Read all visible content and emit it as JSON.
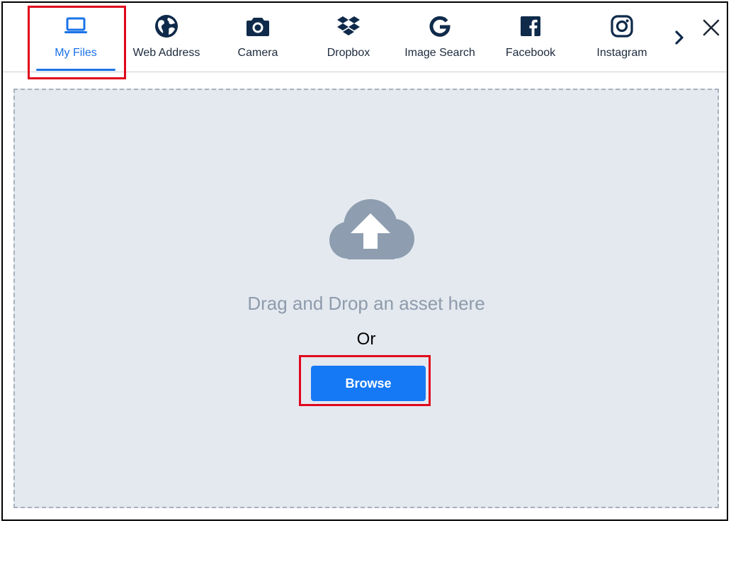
{
  "tabs": [
    {
      "label": "My Files",
      "icon": "laptop-icon",
      "active": true
    },
    {
      "label": "Web Address",
      "icon": "globe-icon",
      "active": false
    },
    {
      "label": "Camera",
      "icon": "camera-icon",
      "active": false
    },
    {
      "label": "Dropbox",
      "icon": "dropbox-icon",
      "active": false
    },
    {
      "label": "Image Search",
      "icon": "google-icon",
      "active": false
    },
    {
      "label": "Facebook",
      "icon": "facebook-icon",
      "active": false
    },
    {
      "label": "Instagram",
      "icon": "instagram-icon",
      "active": false
    }
  ],
  "nav": {
    "more_icon": "chevron-right-icon",
    "close_icon": "close-icon"
  },
  "dropzone": {
    "icon": "cloud-upload-icon",
    "drag_text": "Drag and Drop an asset here",
    "or_text": "Or",
    "browse_label": "Browse"
  },
  "colors": {
    "accent": "#1a73e8",
    "button": "#1579f5",
    "dropzone_bg": "#e4e9f0",
    "icon_dark": "#0f2a4a",
    "highlight": "#e0061c"
  }
}
